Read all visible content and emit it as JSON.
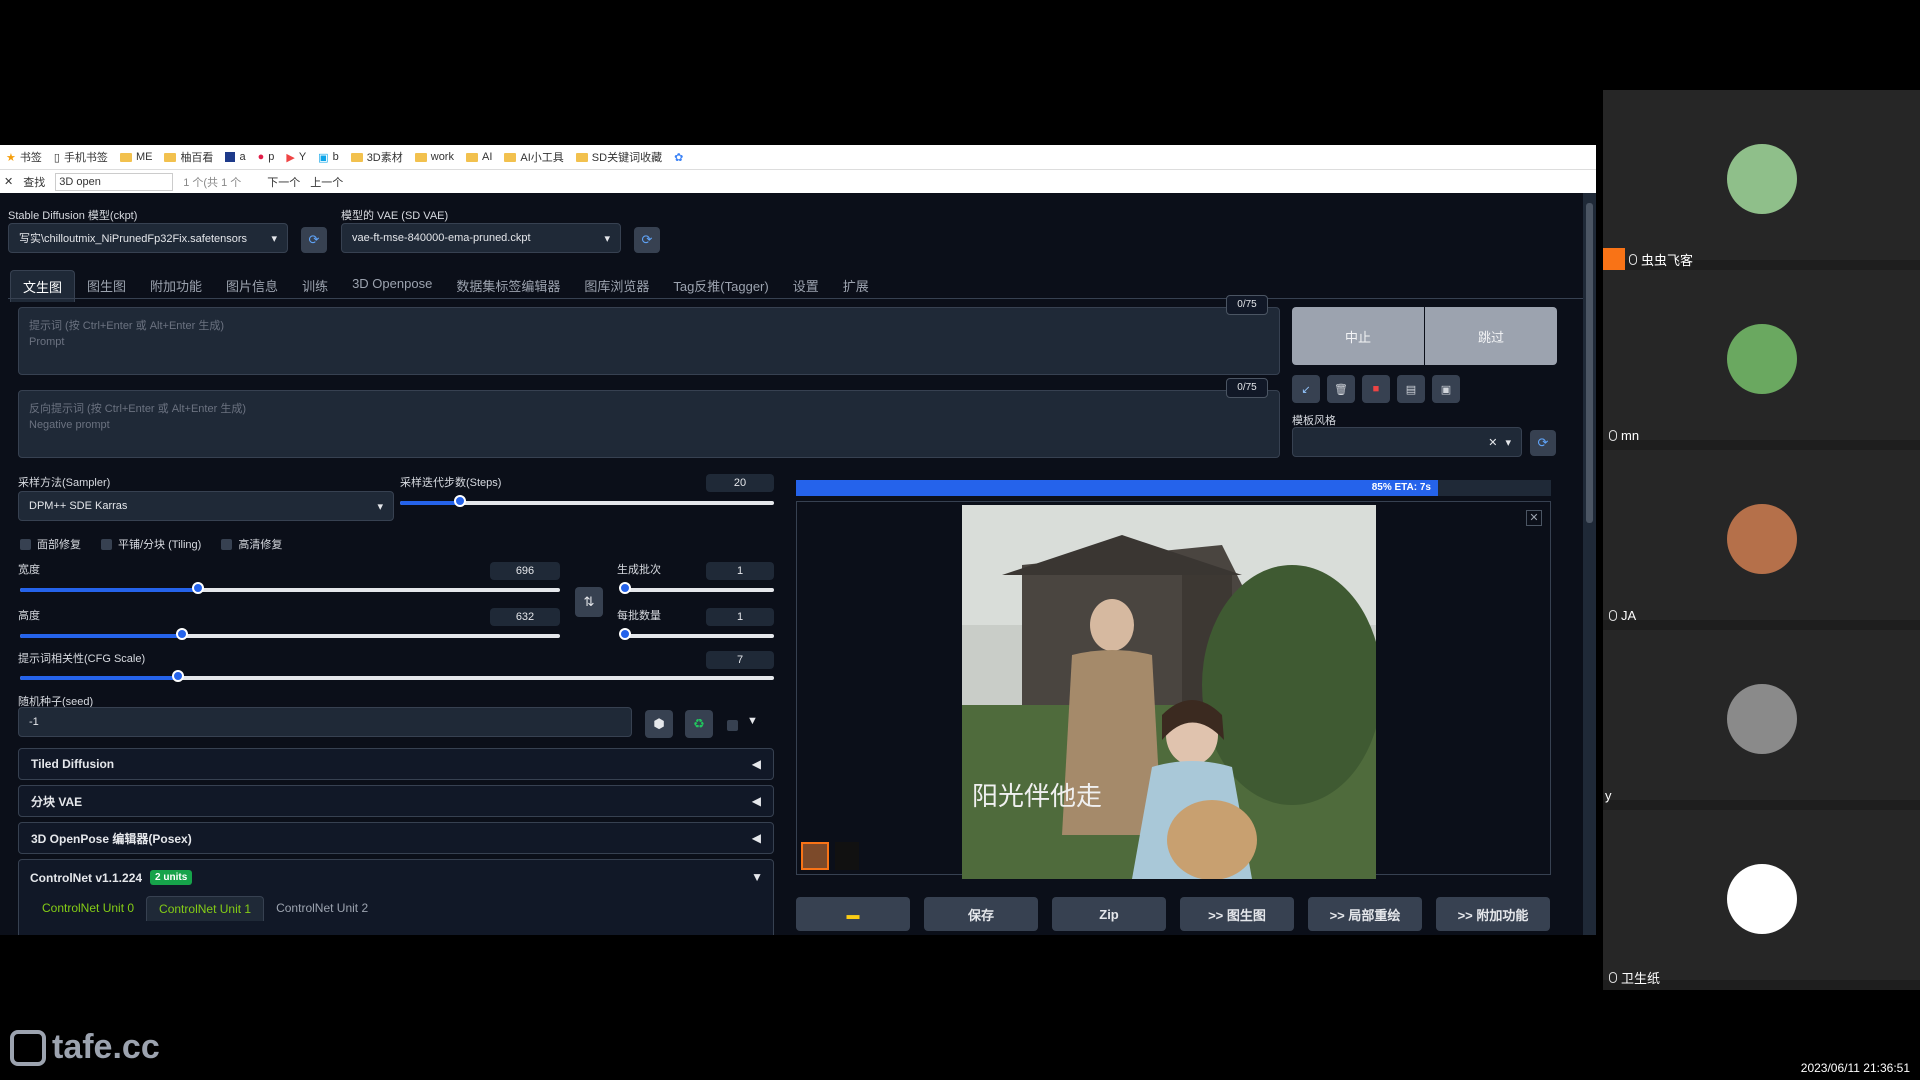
{
  "bookmarks": [
    "书签",
    "手机书签",
    "ME",
    "柚百看",
    "a",
    "p",
    "Y",
    "b",
    "3D素材",
    "work",
    "AI",
    "AI小工具",
    "SD关键词收藏"
  ],
  "findbar": {
    "label": "查找",
    "value": "3D open",
    "count": "1 个(共 1 个",
    "next": "下一个",
    "prev": "上一个"
  },
  "model": {
    "label": "Stable Diffusion 模型(ckpt)",
    "value": "写实\\chilloutmix_NiPrunedFp32Fix.safetensors"
  },
  "vae": {
    "label": "模型的 VAE (SD VAE)",
    "value": "vae-ft-mse-840000-ema-pruned.ckpt"
  },
  "tabs": [
    "文生图",
    "图生图",
    "附加功能",
    "图片信息",
    "训练",
    "3D Openpose",
    "数据集标签编辑器",
    "图库浏览器",
    "Tag反推(Tagger)",
    "设置",
    "扩展"
  ],
  "prompt": {
    "placeholder": "提示词 (按 Ctrl+Enter 或 Alt+Enter 生成)",
    "sub": "Prompt",
    "counter": "0/75"
  },
  "negative": {
    "placeholder": "反向提示词 (按 Ctrl+Enter 或 Alt+Enter 生成)",
    "sub": "Negative prompt",
    "counter": "0/75"
  },
  "actions": {
    "interrupt": "中止",
    "skip": "跳过",
    "styles_label": "模板风格"
  },
  "sampler": {
    "label": "采样方法(Sampler)",
    "value": "DPM++ SDE Karras"
  },
  "steps": {
    "label": "采样迭代步数(Steps)",
    "value": "20",
    "fraction": 0.16
  },
  "checks": [
    "面部修复",
    "平铺/分块 (Tiling)",
    "高清修复"
  ],
  "width": {
    "label": "宽度",
    "value": "696",
    "fraction": 0.33
  },
  "height": {
    "label": "高度",
    "value": "632",
    "fraction": 0.3
  },
  "batch_count": {
    "label": "生成批次",
    "value": "1",
    "fraction": 0.0
  },
  "batch_size": {
    "label": "每批数量",
    "value": "1",
    "fraction": 0.0
  },
  "cfg": {
    "label": "提示词相关性(CFG Scale)",
    "value": "7",
    "fraction": 0.21
  },
  "seed": {
    "label": "随机种子(seed)",
    "value": "-1"
  },
  "accordions": [
    "Tiled Diffusion",
    "分块 VAE",
    "3D OpenPose 编辑器(Posex)"
  ],
  "controlnet": {
    "title": "ControlNet v1.1.224",
    "badge": "2 units",
    "units": [
      "ControlNet Unit 0",
      "ControlNet Unit 1",
      "ControlNet Unit 2"
    ]
  },
  "progress": {
    "text": "85% ETA: 7s",
    "fraction": 0.85
  },
  "output_buttons": [
    "保存",
    "Zip",
    ">> 图生图",
    ">> 局部重绘",
    ">> 附加功能"
  ],
  "image_caption": "阳光伴他走",
  "participants": [
    {
      "name": "虫虫飞客",
      "color": "#8fbf8a"
    },
    {
      "name": "mn",
      "color": "#6aa860"
    },
    {
      "name": "JA",
      "color": "#b5704a"
    },
    {
      "name": "y",
      "color": "#8a8a8a"
    },
    {
      "name": "卫生纸",
      "color": "#ffffff"
    }
  ],
  "watermark": "tafe.cc",
  "timestamp": "2023/06/11 21:36:51"
}
